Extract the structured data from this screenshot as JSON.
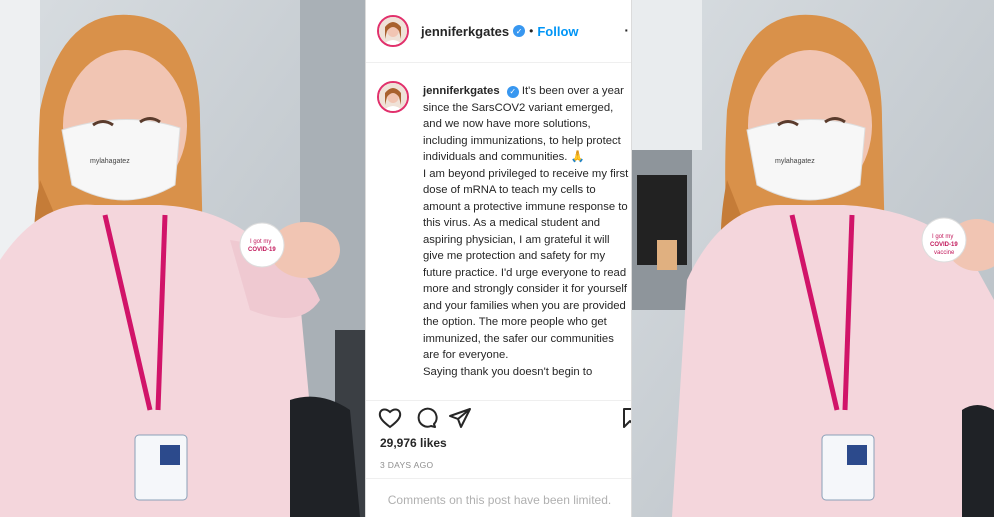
{
  "post": {
    "username": "jenniferkgates",
    "verified_icon": "verified-badge-icon",
    "separator": "•",
    "follow_label": "Follow",
    "more_icon": "more-options-icon",
    "caption_username": "jenniferkgates",
    "caption_text": "It's been over a year since the SarsCOV2 variant emerged, and we now have more solutions, including immunizations, to help protect individuals and communities. 🙏\nI am beyond privileged to receive my first dose of mRNA to teach my cells to amount a protective immune response to this virus. As a medical student and aspiring physician, I am grateful it will give me protection and safety for my future practice. I'd urge everyone to read more and strongly consider it for yourself and your families when you are provided the option. The more people who get immunized, the safer our communities are for everyone.\nSaying thank you doesn't begin to",
    "likes": "29,976 likes",
    "posted_ago": "3 DAYS AGO",
    "comments_notice": "Comments on this post have been limited.",
    "icons": {
      "like": "heart-icon",
      "comment": "comment-icon",
      "share": "share-icon",
      "save": "bookmark-icon"
    }
  },
  "photo": {
    "badge_text_line1": "I got my",
    "badge_text_line2": "COVID-19",
    "badge_text_line3": "vaccine",
    "mask_print": "mylahagatez"
  },
  "colors": {
    "accent_blue": "#0095f6",
    "wall": "#c9cfd4",
    "sweater": "#f4d6dc",
    "lanyard": "#d11469",
    "hair": "#d9914a"
  }
}
